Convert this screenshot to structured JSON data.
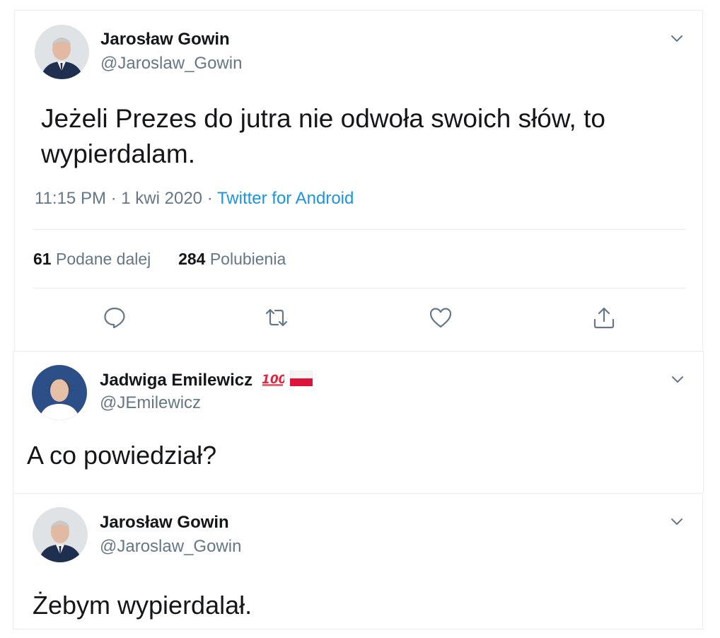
{
  "tweets": [
    {
      "author_name": "Jarosław Gowin",
      "author_handle": "@Jaroslaw_Gowin",
      "text_line1": "Jeżeli Prezes do jutra nie odwoła swoich słów, to",
      "text_line2": "wypierdalam.",
      "time": "11:15 PM",
      "date": "1 kwi 2020",
      "separator": " · ",
      "source": "Twitter for Android",
      "retweets_count": "61",
      "retweets_label": "Podane dalej",
      "likes_count": "284",
      "likes_label": "Polubienia",
      "actions": [
        "reply-icon",
        "retweet-icon",
        "like-icon",
        "share-icon"
      ]
    },
    {
      "author_name": "Jadwiga Emilewicz",
      "author_handle": "@JEmilewicz",
      "emoji": [
        "hundred-points-emoji",
        "poland-flag-emoji"
      ],
      "text": "A co powiedział?"
    },
    {
      "author_name": "Jarosław Gowin",
      "author_handle": "@Jaroslaw_Gowin",
      "text": "Żebym wypierdalał."
    }
  ],
  "colors": {
    "text": "#14171a",
    "secondary": "#657786",
    "link": "#1b95e0",
    "border": "#e6ecf0"
  }
}
